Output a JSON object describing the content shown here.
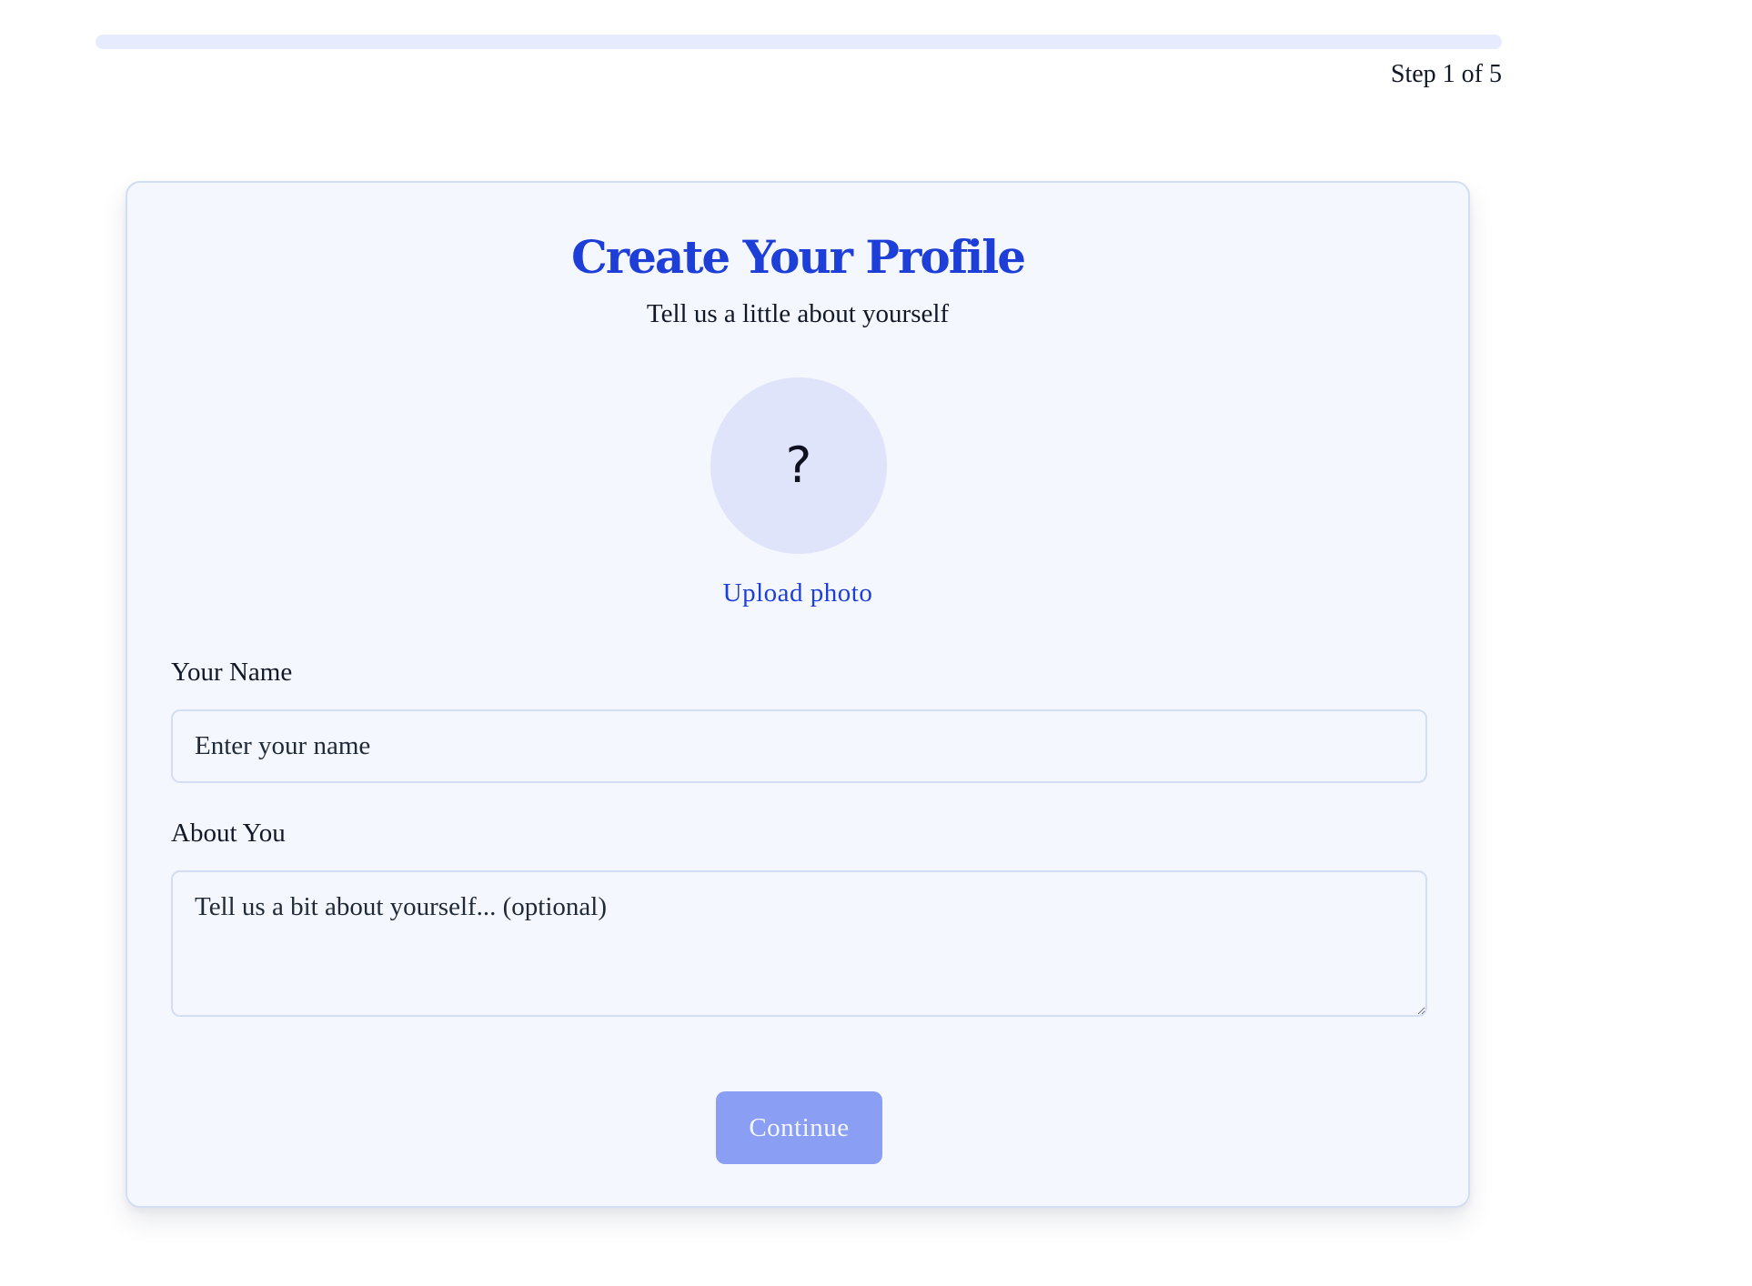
{
  "progress": {
    "step_text": "Step 1 of 5",
    "current_step": 1,
    "total_steps": 5,
    "fill_fraction": 0,
    "track_color": "#e6ecfd",
    "fill_color": "#5b6ff0"
  },
  "card": {
    "title": "Create Your Profile",
    "subtitle": "Tell us a little about yourself",
    "avatar": {
      "icon": "question-mark-icon",
      "glyph": "?",
      "background_color": "#dfe4fb"
    },
    "upload_label": "Upload photo",
    "name_field": {
      "label": "Your Name",
      "value": "",
      "placeholder": "Enter your name"
    },
    "about_field": {
      "label": "About You",
      "value": "",
      "placeholder": "Tell us a bit about yourself... (optional)"
    },
    "continue_label": "Continue",
    "continue_disabled": true
  },
  "colors": {
    "accent": "#1d3fd8",
    "card_background": "#f4f7fe",
    "card_border": "#d3def2",
    "button_disabled": "#8a9ff3"
  }
}
